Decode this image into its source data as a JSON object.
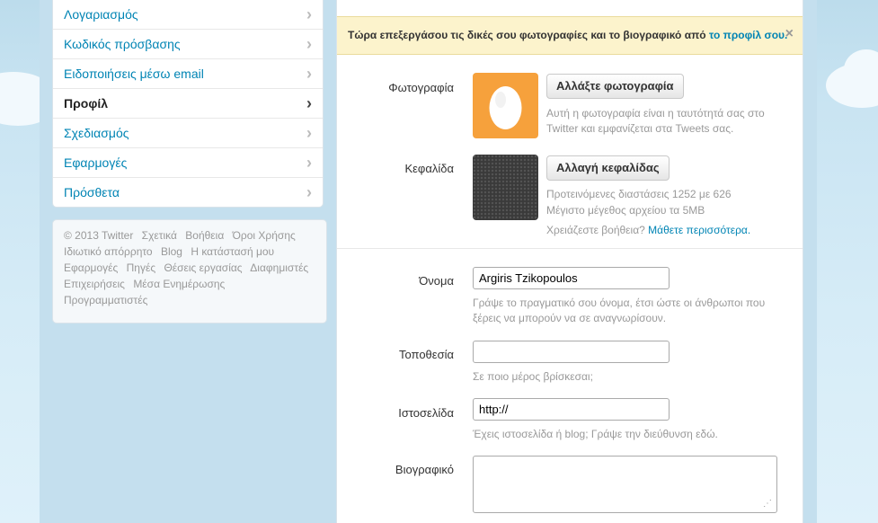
{
  "sidebar": {
    "items": [
      {
        "label": "Λογαριασμός",
        "active": false
      },
      {
        "label": "Κωδικός πρόσβασης",
        "active": false
      },
      {
        "label": "Ειδοποιήσεις μέσω email",
        "active": false
      },
      {
        "label": "Προφίλ",
        "active": true
      },
      {
        "label": "Σχεδιασμός",
        "active": false
      },
      {
        "label": "Εφαρμογές",
        "active": false
      },
      {
        "label": "Πρόσθετα",
        "active": false
      }
    ],
    "chevron": "›"
  },
  "footer": {
    "links": [
      "© 2013 Twitter",
      "Σχετικά",
      "Βοήθεια",
      "Όροι Χρήσης",
      "Ιδιωτικό απόρρητο",
      "Blog",
      "Η κατάστασή μου",
      "Εφαρμογές",
      "Πηγές",
      "Θέσεις εργασίας",
      "Διαφημιστές",
      "Επιχειρήσεις",
      "Μέσα Ενημέρωσης",
      "Προγραμματιστές"
    ]
  },
  "banner": {
    "text": "Τώρα επεξεργάσου τις δικές σου φωτογραφίες και το βιογραφικό από ",
    "link": "το προφίλ σου.",
    "close": "×"
  },
  "photo": {
    "label": "Φωτογραφία",
    "button": "Αλλάξτε φωτογραφία",
    "help": "Αυτή η φωτογραφία είναι η ταυτότητά σας στο Twitter και εμφανίζεται στα Tweets σας."
  },
  "header": {
    "label": "Κεφαλίδα",
    "button": "Αλλαγή κεφαλίδας",
    "help_line1": "Προτεινόμενες διαστάσεις 1252 με 626",
    "help_line2": "Μέγιστο μέγεθος αρχείου τα 5MB",
    "need_help": "Χρειάζεστε βοήθεια?",
    "learn_more": "Μάθετε περισσότερα."
  },
  "name": {
    "label": "Όνομα",
    "value": "Argiris Tzikopoulos",
    "help": "Γράψε το πραγματικό σου όνομα, έτσι ώστε οι άνθρωποι που ξέρεις να μπορούν να σε αναγνωρίσουν."
  },
  "location": {
    "label": "Τοποθεσία",
    "value": "",
    "help": "Σε ποιο μέρος βρίσκεσαι;"
  },
  "website": {
    "label": "Ιστοσελίδα",
    "value": "http://",
    "help": "Έχεις ιστοσελίδα ή blog; Γράψε την διεύθυνση εδώ."
  },
  "bio": {
    "label": "Βιογραφικό",
    "value": ""
  },
  "colors": {
    "link": "#0084b4",
    "avatar_bg": "#f6a13c",
    "banner_bg": "#fcf3cc",
    "page_bg": "#c0deed"
  }
}
